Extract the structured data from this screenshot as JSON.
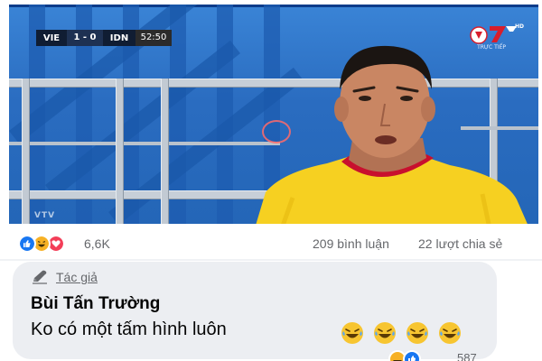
{
  "video": {
    "scoreboard": {
      "team_home": "VIE",
      "score": "1 - 0",
      "team_away": "IDN",
      "clock": "52:50"
    },
    "channel_logo": "channel-logo-icon",
    "channel_sub": "TRỰC TIẾP",
    "watermark": "VTV"
  },
  "reactions": {
    "icons": [
      "like-icon",
      "haha-icon",
      "love-icon"
    ],
    "count": "6,6K",
    "comments": "209 bình luận",
    "shares": "22 lượt chia sẻ"
  },
  "comment": {
    "badge_icon": "pencil-icon",
    "badge_label": "Tác giả",
    "author": "Bùi Tấn Trường",
    "text": "Ko có một tấm hình luôn",
    "emojis": [
      "laughing-tears-emoji",
      "laughing-tears-emoji",
      "laughing-tears-emoji",
      "laughing-tears-emoji"
    ],
    "reactions": [
      "haha-icon",
      "like-icon"
    ],
    "reaction_count": "587"
  },
  "colors": {
    "like_blue": "#1877f2",
    "love_red": "#f33e58",
    "haha_yellow": "#f7b125",
    "jersey_yellow": "#f6d021",
    "jersey_red": "#c8102e",
    "comment_bg": "#eceef2"
  }
}
